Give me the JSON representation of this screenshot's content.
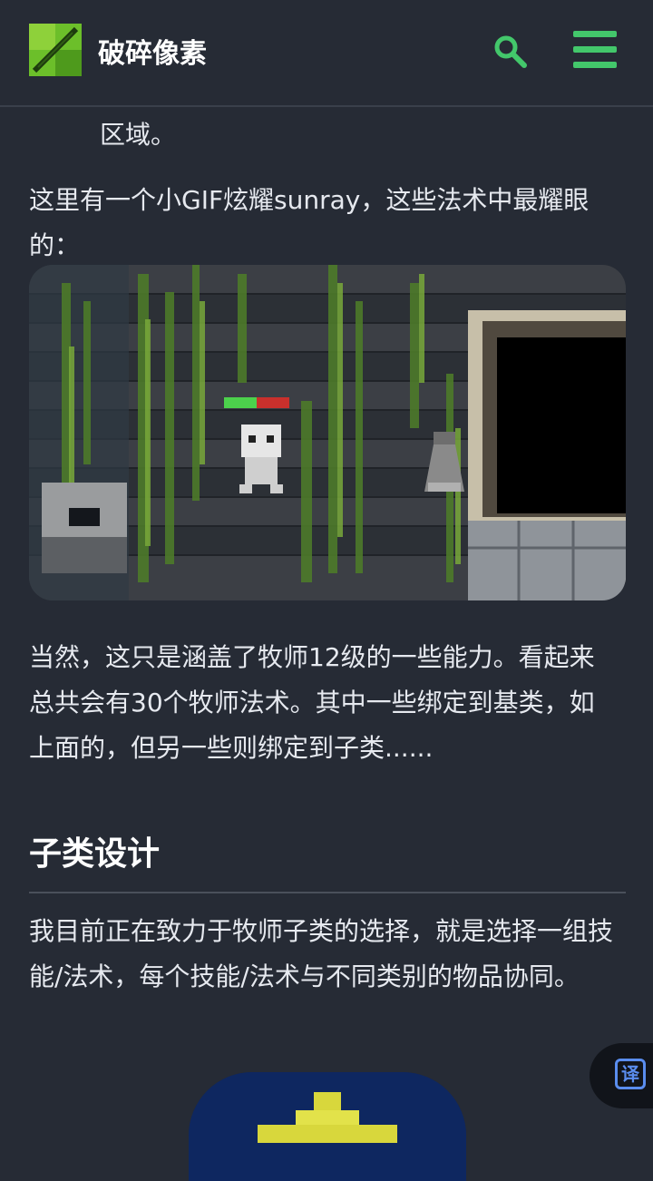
{
  "header": {
    "site_title": "破碎像素",
    "accent_color": "#43c76b"
  },
  "article": {
    "p1": "区域。",
    "p2": "这里有一个小GIF炫耀sunray，这些法术中最耀眼的：",
    "p3": "当然，这只是涵盖了牧师12级的一些能力。看起来总共会有30个牧师法术。其中一些绑定到基类，如上面的，但另一些则绑定到子类......",
    "h2": "子类设计",
    "p4": "我目前正在致力于牧师子类的选择，就是选择一组技能/法术，每个技能/法术与不同类别的物品协同。"
  },
  "icons": {
    "logo": "pixel-wand-logo",
    "search": "search-icon",
    "menu": "hamburger-menu-icon",
    "translate": "translate-icon"
  },
  "translate_button": {
    "label": "译"
  }
}
